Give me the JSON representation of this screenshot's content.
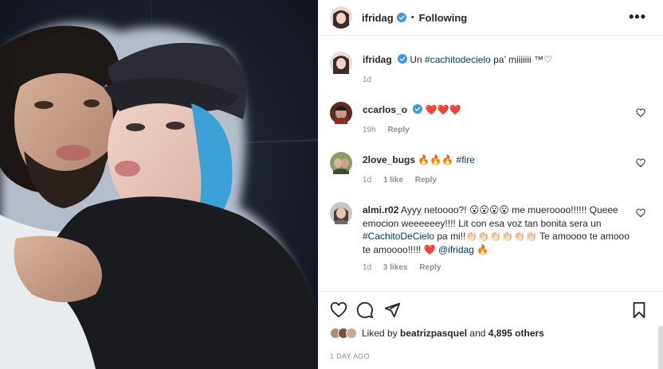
{
  "post": {
    "username": "ifridag",
    "dot": "•",
    "following_label": "Following",
    "more_label": "•••"
  },
  "caption": {
    "username": "ifridag",
    "text_pre": "Un ",
    "hashtag": "#cachitodecielo",
    "text_post": " pa’ miiiiiii ™♡",
    "time": "1d"
  },
  "comments": [
    {
      "username": "ccarlos_o",
      "verified": true,
      "text": "❤️❤️❤️",
      "time": "19h",
      "likes": "",
      "reply": "Reply"
    },
    {
      "username": "2love_bugs",
      "verified": false,
      "text": "🔥🔥🔥 ",
      "hashtag": "#fire",
      "time": "1d",
      "likes": "1 like",
      "reply": "Reply"
    },
    {
      "username": "almi.r02",
      "verified": false,
      "text_1": " Ayyy netoooo?! 😮😮😮😮 me mueroooo!!!!!! Queee emocion weeeeeey!!!! Lit con esa voz tan bonita sera un ",
      "hashtag": "#CachitoDeCielo",
      "text_2": " pa mi!!👏🏻👏🏻👏🏻👏🏻👏🏻👏🏻 Te amoooo te amooo te amoooo!!!!! ❤️ ",
      "mention": "@ifridag",
      "text_3": " 🔥",
      "time": "1d",
      "likes": "3 likes",
      "reply": "Reply"
    }
  ],
  "footer": {
    "liked_by_label": "Liked by",
    "liked_by_user": "beatrizpasquel",
    "and_label": "and",
    "others": "4,895 others",
    "ago": "1 DAY AGO"
  },
  "colors": {
    "verified": "#3897f0",
    "link": "#00376b",
    "muted": "#8e8e8e",
    "heart": "#ed4956"
  },
  "icons": [
    "verified-badge-icon",
    "more-options-icon",
    "heart-icon",
    "comment-icon",
    "share-icon",
    "bookmark-icon"
  ]
}
